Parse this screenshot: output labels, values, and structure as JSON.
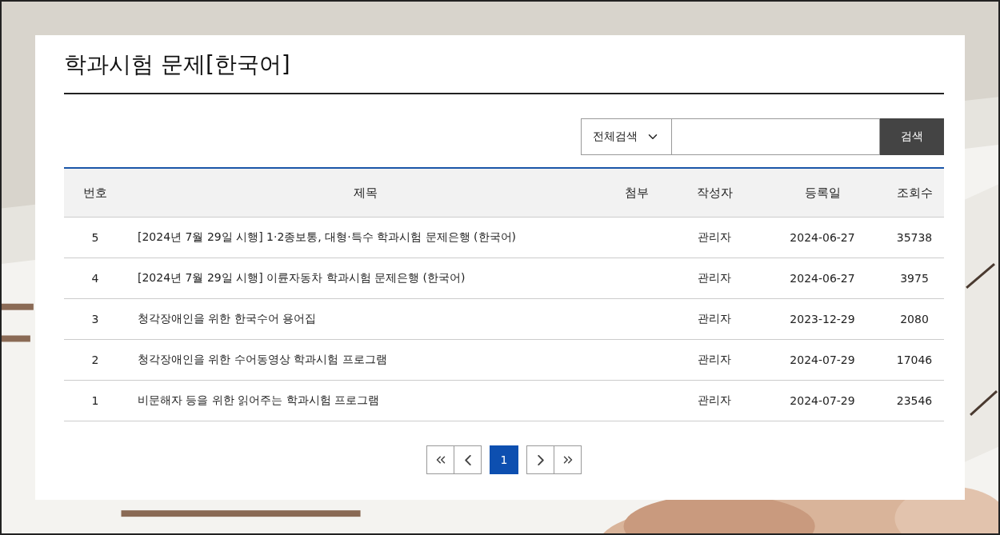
{
  "title": "학과시험 문제[한국어]",
  "search": {
    "scope": "전체검색",
    "button": "검색"
  },
  "table": {
    "columns": [
      "번호",
      "제목",
      "첨부",
      "작성자",
      "등록일",
      "조회수"
    ],
    "rows": [
      {
        "number": "5",
        "title": "[2024년 7월 29일 시행] 1·2종보통, 대형·특수 학과시험 문제은행 (한국어)",
        "author": "관리자",
        "date": "2024-06-27",
        "views": "35738"
      },
      {
        "number": "4",
        "title": "[2024년 7월 29일 시행] 이륜자동차 학과시험 문제은행 (한국어)",
        "author": "관리자",
        "date": "2024-06-27",
        "views": "3975"
      },
      {
        "number": "3",
        "title": "청각장애인을 위한 한국수어 용어집",
        "author": "관리자",
        "date": "2023-12-29",
        "views": "2080"
      },
      {
        "number": "2",
        "title": "청각장애인을 위한 수어동영상 학과시험 프로그램",
        "author": "관리자",
        "date": "2024-07-29",
        "views": "17046"
      },
      {
        "number": "1",
        "title": "비문해자 등을 위한 읽어주는 학과시험 프로그램",
        "author": "관리자",
        "date": "2024-07-29",
        "views": "23546"
      }
    ]
  },
  "pagination": {
    "pages": [
      {
        "label": "1",
        "selected": true
      }
    ]
  }
}
